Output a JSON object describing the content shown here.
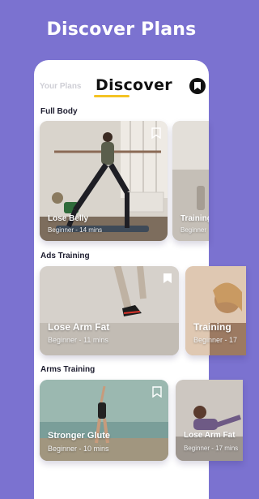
{
  "header": {
    "title": "Discover Plans"
  },
  "tabs": {
    "inactive": "Your Plans",
    "active": "Discover"
  },
  "sections": [
    {
      "title": "Full Body",
      "cards": [
        {
          "title": "Lose Belly",
          "meta": "Beginner - 14 mins"
        },
        {
          "title": "Training",
          "meta": "Beginner"
        }
      ]
    },
    {
      "title": "Ads Training",
      "cards": [
        {
          "title": "Lose Arm Fat",
          "meta": "Beginner - 11 mins"
        },
        {
          "title": "Training",
          "meta": "Beginner - 17"
        }
      ]
    },
    {
      "title": "Arms Training",
      "cards": [
        {
          "title": "Stronger Glute",
          "meta": "Beginner - 10 mins"
        },
        {
          "title": "Lose Arm Fat",
          "meta": "Beginner - 17 mins"
        }
      ]
    }
  ],
  "colors": {
    "background": "#7b72d0",
    "tab_underline": "#f4c324",
    "card_text": "#ffffff"
  },
  "icons": {
    "bookmark": "bookmark-icon"
  }
}
